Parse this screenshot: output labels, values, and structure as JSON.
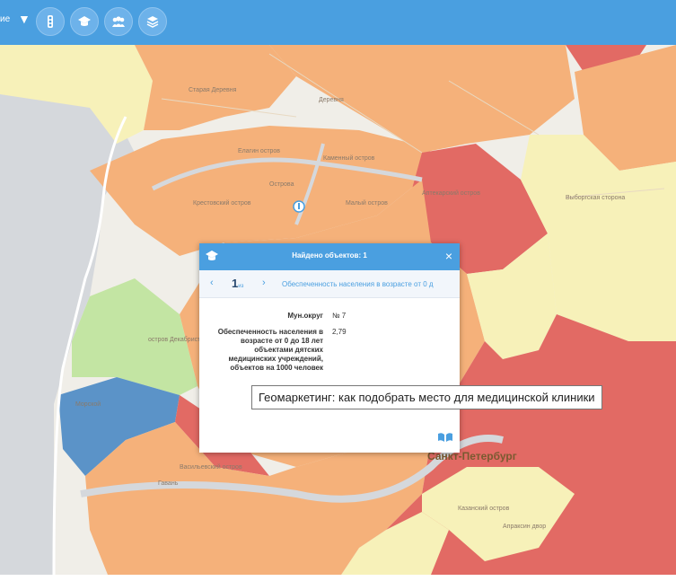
{
  "toolbar": {
    "partial_text": "ие",
    "caret": "▼",
    "buttons": [
      {
        "name": "traffic-light-icon"
      },
      {
        "name": "graduation-cap-icon"
      },
      {
        "name": "group-icon"
      },
      {
        "name": "layers-icon"
      }
    ]
  },
  "colors": {
    "toolbar": "#4a9fe0",
    "orange": "#f5b17a",
    "red": "#e26a64",
    "yellow": "#f7f1b9",
    "green": "#c3e5a3",
    "blue": "#5b93c8",
    "water": "#d5d8dc"
  },
  "map_labels": {
    "staraya_derevnya": "Старая Деревня",
    "derevnya": "Деревня",
    "elagin": "Елагин остров",
    "kamenny": "Каменный остров",
    "krestovsky": "Крестовский остров",
    "ostrov": "Острова",
    "aptekarsky": "Аптекарский остров",
    "vyborgskaya": "Выборгская сторона",
    "dekabristov": "остров Декабристов",
    "morskoy": "Морской",
    "gavan": "Гавань",
    "vasilievsky": "Васильевский остров",
    "kazansky": "Казанский остров",
    "apraksin": "Апраксин двор",
    "maly": "Малый остров"
  },
  "city_label": "Санкт-Петербург",
  "popup": {
    "title": "Найдено объектов: 1",
    "close": "×",
    "nav": {
      "prev": "‹",
      "number": "1",
      "unit": "из",
      "next": "›",
      "field": "Обеспеченность населения в возрасте от 0 д"
    },
    "rows": [
      {
        "label": "Мун.округ",
        "value": "№ 7"
      },
      {
        "label": "Обеспеченность населения в возрасте от 0 до 18 лет объектами дятских медицинских учреждений, объектов на 1000 человек",
        "value": "2,79"
      }
    ]
  },
  "tooltip": "Геомаркетинг: как подобрать место для медицинской клиники"
}
